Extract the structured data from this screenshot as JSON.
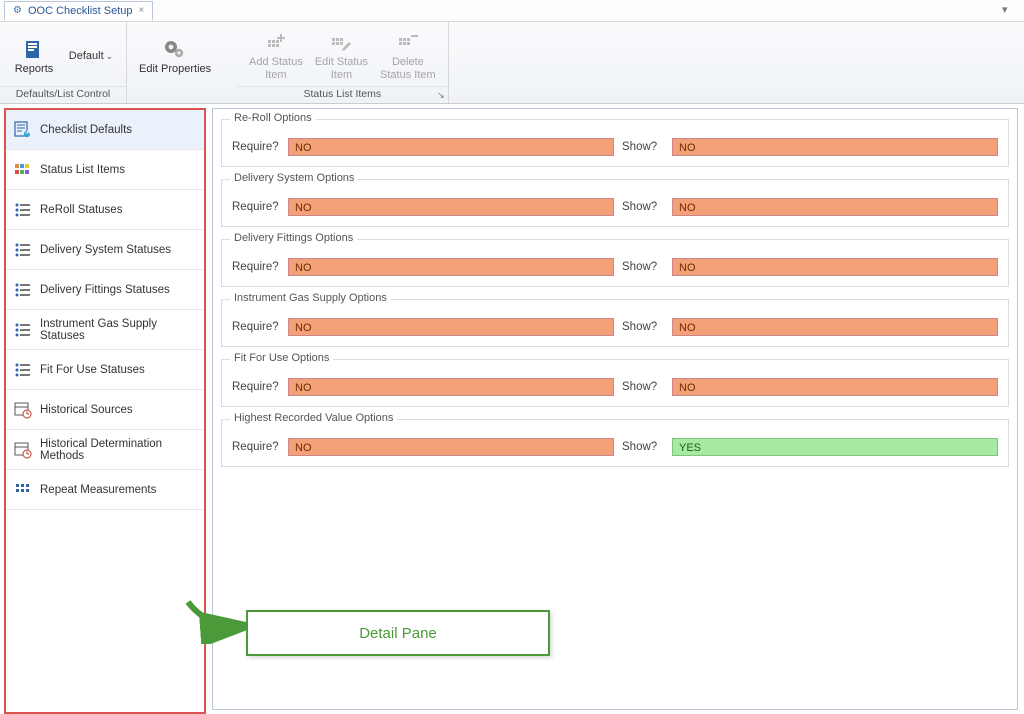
{
  "tab": {
    "title": "OOC Checklist Setup"
  },
  "ribbon": {
    "reports": {
      "label": "Reports"
    },
    "default_dropdown": {
      "label": "Default"
    },
    "group1_label": "Defaults/List Control",
    "edit_properties": {
      "label": "Edit Properties"
    },
    "add_status": {
      "line1": "Add Status",
      "line2": "Item"
    },
    "edit_status": {
      "line1": "Edit Status",
      "line2": "Item"
    },
    "delete_status": {
      "line1": "Delete",
      "line2": "Status Item"
    },
    "group2_label": "Status List Items"
  },
  "sidebar": {
    "items": [
      {
        "label": "Checklist Defaults"
      },
      {
        "label": "Status List Items"
      },
      {
        "label": "ReRoll Statuses"
      },
      {
        "label": "Delivery System Statuses"
      },
      {
        "label": "Delivery Fittings Statuses"
      },
      {
        "label": "Instrument Gas Supply Statuses"
      },
      {
        "label": "Fit For Use Statuses"
      },
      {
        "label": "Historical Sources"
      },
      {
        "label": "Historical Determination Methods"
      },
      {
        "label": "Repeat Measurements"
      }
    ]
  },
  "groups": [
    {
      "title": "Re-Roll Options",
      "require_label": "Require?",
      "require_val": "NO",
      "show_label": "Show?",
      "show_val": "NO",
      "show_yes": false
    },
    {
      "title": "Delivery System Options",
      "require_label": "Require?",
      "require_val": "NO",
      "show_label": "Show?",
      "show_val": "NO",
      "show_yes": false
    },
    {
      "title": "Delivery Fittings Options",
      "require_label": "Require?",
      "require_val": "NO",
      "show_label": "Show?",
      "show_val": "NO",
      "show_yes": false
    },
    {
      "title": "Instrument Gas Supply Options",
      "require_label": "Require?",
      "require_val": "NO",
      "show_label": "Show?",
      "show_val": "NO",
      "show_yes": false
    },
    {
      "title": "Fit For Use Options",
      "require_label": "Require?",
      "require_val": "NO",
      "show_label": "Show?",
      "show_val": "NO",
      "show_yes": false
    },
    {
      "title": "Highest Recorded Value Options",
      "require_label": "Require?",
      "require_val": "NO",
      "show_label": "Show?",
      "show_val": "YES",
      "show_yes": true
    }
  ],
  "annotation": {
    "label": "Detail Pane"
  }
}
